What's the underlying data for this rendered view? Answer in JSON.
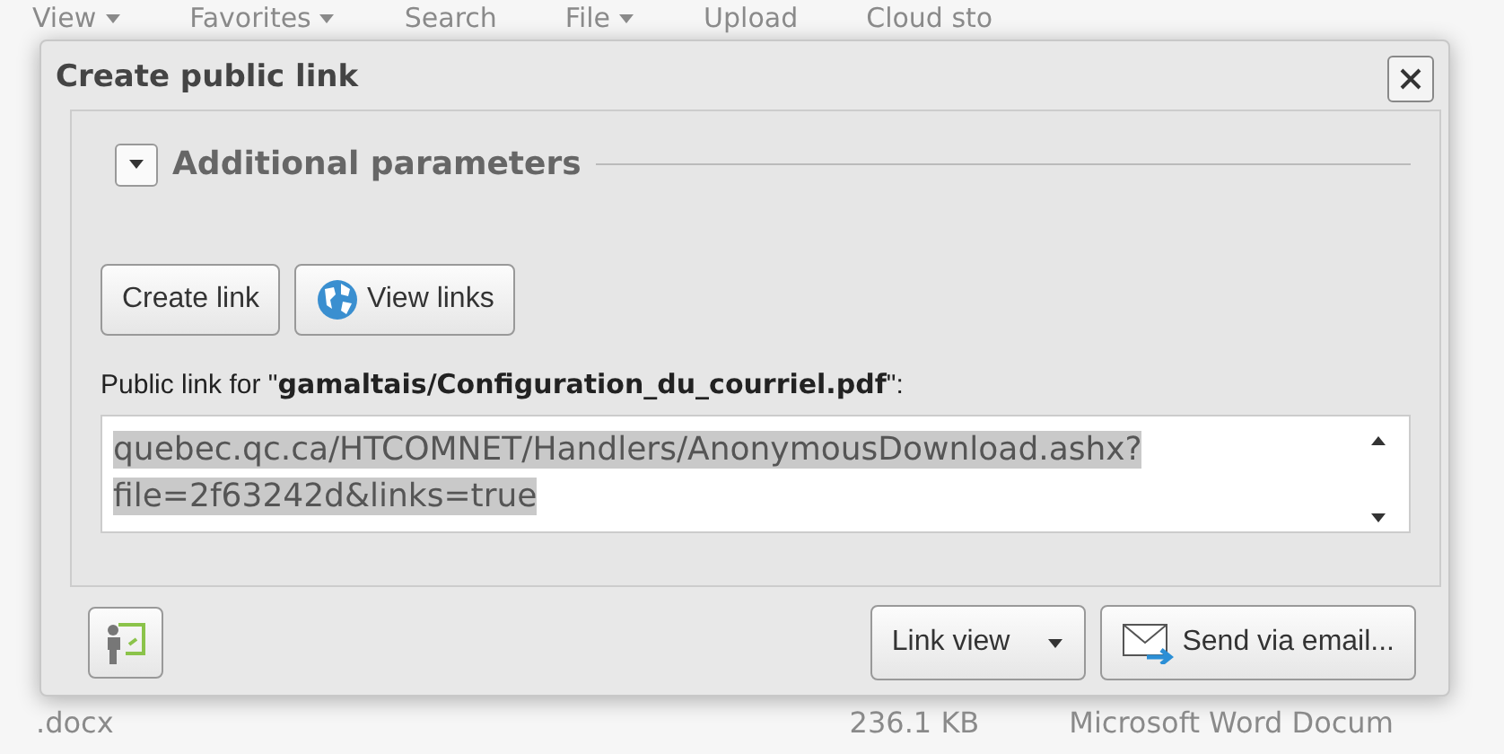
{
  "background": {
    "toolbar": [
      {
        "label": "View",
        "dropdown": true
      },
      {
        "label": "Favorites",
        "dropdown": true
      },
      {
        "label": "Search",
        "dropdown": false
      },
      {
        "label": "File",
        "dropdown": true
      },
      {
        "label": "Upload",
        "dropdown": false
      },
      {
        "label": "Cloud sto",
        "dropdown": false
      }
    ],
    "file_row": {
      "name": ".docx",
      "size": "236.1 KB",
      "type": "Microsoft Word Docum"
    }
  },
  "dialog": {
    "title": "Create public link",
    "parameters": {
      "label": "Additional parameters",
      "expanded": false
    },
    "buttons": [
      {
        "label": "Create link",
        "kind": "plain"
      },
      {
        "label": "View links",
        "kind": "globe"
      }
    ],
    "link_label": "Public link for \"**gamaltais/Configuration_du_courriel.pdf**\":",
    "link": {
      "lines": [
        "quebec.qc.ca/HTCOMNET/Handlers/AnonymousDownload.ashx?",
        "file=2f63242d&links=true"
      ],
      "selected": true
    },
    "footer": [
      {
        "label": "Link view",
        "kind": "dropdown"
      },
      {
        "label": "Send via email...",
        "kind": "email"
      }
    ]
  }
}
